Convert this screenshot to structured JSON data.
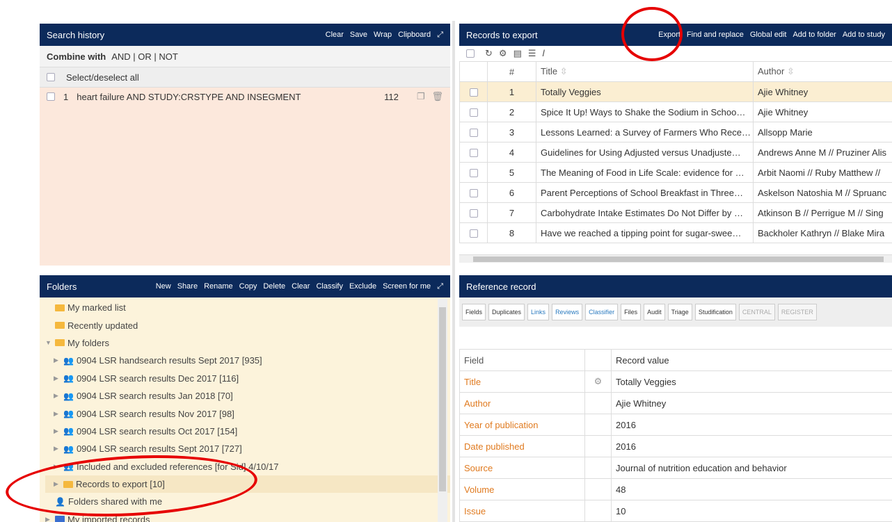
{
  "search_history": {
    "title": "Search history",
    "actions": [
      "Clear",
      "Save",
      "Wrap",
      "Clipboard"
    ],
    "combine_label": "Combine with",
    "combine_ops": "AND | OR | NOT",
    "select_all": "Select/deselect all",
    "rows": [
      {
        "num": "1",
        "query": "heart failure AND STUDY:CRSTYPE AND INSEGMENT",
        "count": "112"
      }
    ]
  },
  "records": {
    "title": "Records to export",
    "actions": [
      "Export",
      "Find and replace",
      "Global edit",
      "Add to folder",
      "Add to study"
    ],
    "columns": [
      "#",
      "Title",
      "Author"
    ],
    "rows": [
      {
        "n": "1",
        "title": "Totally Veggies",
        "author": "Ajie Whitney"
      },
      {
        "n": "2",
        "title": "Spice It Up! Ways to Shake the Sodium in Schoo…",
        "author": "Ajie Whitney"
      },
      {
        "n": "3",
        "title": "Lessons Learned: a Survey of Farmers Who Rece…",
        "author": "Allsopp Marie"
      },
      {
        "n": "4",
        "title": "Guidelines for Using Adjusted versus Unadjuste…",
        "author": "Andrews Anne M // Pruziner Alis"
      },
      {
        "n": "5",
        "title": "The Meaning of Food in Life Scale: evidence for …",
        "author": "Arbit Naomi // Ruby Matthew //"
      },
      {
        "n": "6",
        "title": "Parent Perceptions of School Breakfast in Three…",
        "author": "Askelson Natoshia M // Spruanc"
      },
      {
        "n": "7",
        "title": "Carbohydrate Intake Estimates Do Not Differ by …",
        "author": "Atkinson B // Perrigue M // Sing"
      },
      {
        "n": "8",
        "title": "Have we reached a tipping point for sugar-swee…",
        "author": "Backholer Kathryn // Blake Mira"
      }
    ]
  },
  "folders": {
    "title": "Folders",
    "actions": [
      "New",
      "Share",
      "Rename",
      "Copy",
      "Delete",
      "Clear",
      "Classify",
      "Exclude",
      "Screen for me"
    ],
    "items": [
      {
        "label": "My marked list"
      },
      {
        "label": "Recently updated"
      },
      {
        "label": "My folders"
      },
      {
        "label": "0904 LSR handsearch results Sept 2017 [935]"
      },
      {
        "label": "0904 LSR search results Dec 2017 [116]"
      },
      {
        "label": "0904 LSR search results Jan 2018 [70]"
      },
      {
        "label": "0904 LSR search results Nov 2017 [98]"
      },
      {
        "label": "0904 LSR search results Oct 2017 [154]"
      },
      {
        "label": "0904 LSR search results Sept 2017 [727]"
      },
      {
        "label": "Included and excluded references [for Sid] 4/10/17"
      },
      {
        "label": "Records to export [10]"
      },
      {
        "label": "Folders shared with me"
      },
      {
        "label": "My imported records"
      }
    ]
  },
  "reference": {
    "title": "Reference record",
    "tabs": [
      "Fields",
      "Duplicates",
      "Links",
      "Reviews",
      "Classifier",
      "Files",
      "Audit",
      "Triage",
      "Studification",
      "CENTRAL",
      "REGISTER"
    ],
    "header_field": "Field",
    "header_value": "Record value",
    "fields": [
      {
        "name": "Title",
        "value": "Totally Veggies"
      },
      {
        "name": "Author",
        "value": "Ajie Whitney"
      },
      {
        "name": "Year of publication",
        "value": "2016"
      },
      {
        "name": "Date published",
        "value": "2016"
      },
      {
        "name": "Source",
        "value": "Journal of nutrition education and behavior"
      },
      {
        "name": "Volume",
        "value": "48"
      },
      {
        "name": "Issue",
        "value": "10"
      }
    ]
  }
}
